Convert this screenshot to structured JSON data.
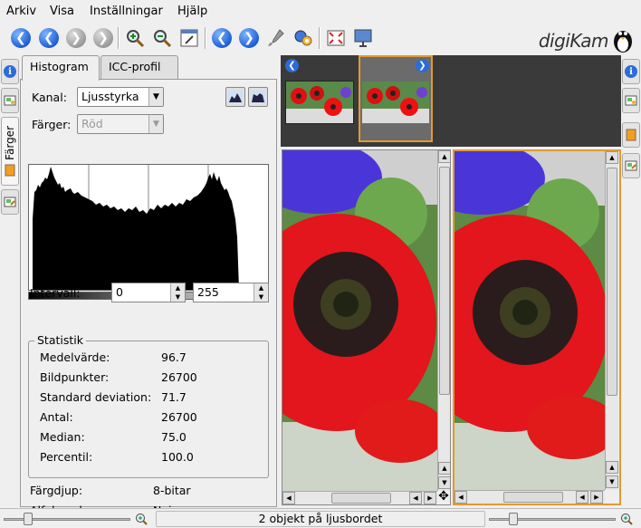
{
  "menu": [
    "Arkiv",
    "Visa",
    "Inställningar",
    "Hjälp"
  ],
  "app_logo": "digiKam",
  "toolbar_icons": [
    "back-icon",
    "back-icon",
    "forward-icon",
    "forward-icon",
    "zoom-in-icon",
    "zoom-out-icon",
    "note-icon",
    "previous-icon",
    "next-icon",
    "brush-icon",
    "gear-icon",
    "fullscreen-icon",
    "slideshow-icon"
  ],
  "left_sidebar_tabs": {
    "active": "Färger"
  },
  "tabs": [
    {
      "label": "Histogram"
    },
    {
      "label": "ICC-profil"
    }
  ],
  "histogram": {
    "kanal_label": "Kanal:",
    "kanal_value": "Ljusstyrka",
    "farger_label": "Färger:",
    "farger_value": "Röd",
    "intervall_label": "Intervall:",
    "range_min": "0",
    "range_max": "255"
  },
  "statistics": {
    "title": "Statistik",
    "rows": [
      {
        "label": "Medelvärde:",
        "value": "96.7"
      },
      {
        "label": "Bildpunkter:",
        "value": "26700"
      },
      {
        "label": "Standard deviation:",
        "value": "71.7"
      },
      {
        "label": "Antal:",
        "value": "26700"
      },
      {
        "label": "Median:",
        "value": "75.0"
      },
      {
        "label": "Percentil:",
        "value": "100.0"
      }
    ]
  },
  "image_info": [
    {
      "label": "Färgdjup:",
      "value": "8-bitar"
    },
    {
      "label": "Alfakanal:",
      "value": "Nej"
    }
  ],
  "status_text": "2 objekt på ljusbordet",
  "colors": {
    "selection": "#e29a2e",
    "accent": "#2d6bd8",
    "thumbbar": "#3a3a3a"
  }
}
